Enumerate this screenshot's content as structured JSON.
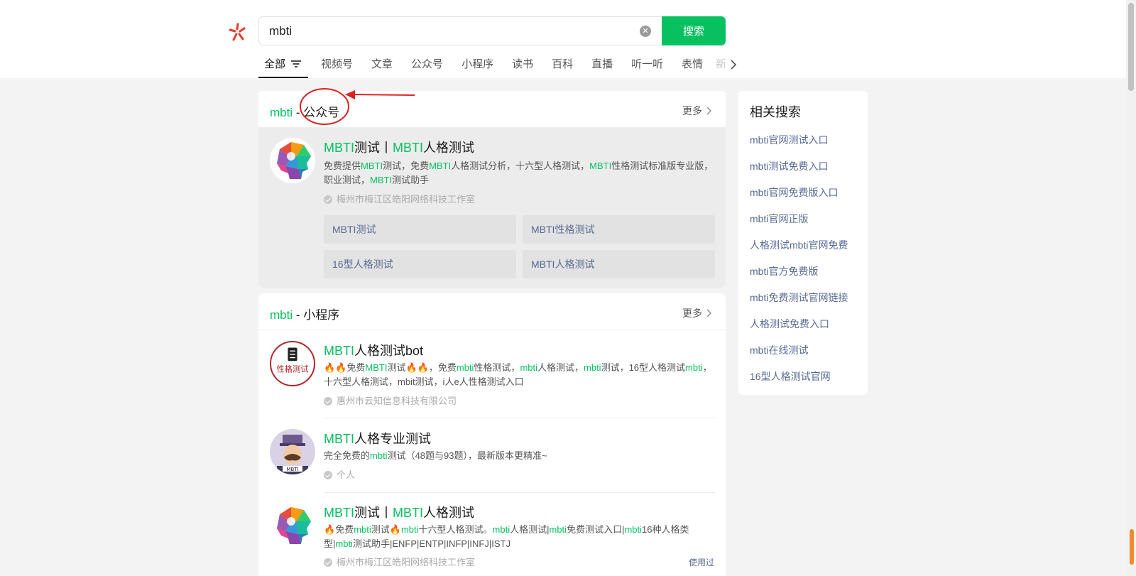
{
  "search": {
    "query": "mbti",
    "clear_icon": "close-circle-icon",
    "button_label": "搜索"
  },
  "tabs": [
    {
      "label": "全部",
      "active": true
    },
    {
      "label": "视频号"
    },
    {
      "label": "文章"
    },
    {
      "label": "公众号"
    },
    {
      "label": "小程序"
    },
    {
      "label": "读书"
    },
    {
      "label": "百科"
    },
    {
      "label": "直播"
    },
    {
      "label": "听一听"
    },
    {
      "label": "表情"
    },
    {
      "label": "新"
    }
  ],
  "accounts": {
    "keyword": "mbti",
    "sep": " - ",
    "title": "公众号",
    "more_label": "更多",
    "item": {
      "title_kw1": "MBTI",
      "title_mid": "测试丨",
      "title_kw2": "MBTI",
      "title_end": "人格测试",
      "desc": [
        "免费提供",
        "MBTI",
        "测试，免费",
        "MBTI",
        "人格测试分析，十六型人格测试，",
        "MBTI",
        "性格测试标准版专业版，职业测试，",
        "MBTI",
        "测试助手"
      ],
      "org": "梅州市梅江区皓阳网络科技工作室",
      "sub_links": [
        "MBTI测试",
        "MBTI性格测试",
        "16型人格测试",
        "MBTI人格测试"
      ]
    }
  },
  "miniprograms": {
    "keyword": "mbti",
    "sep": " - ",
    "title": "小程序",
    "more_label": "更多",
    "items": [
      {
        "title_kw": "MBTI",
        "title_rest": "人格测试bot",
        "desc": [
          "免费",
          "MBTI",
          "测试",
          "，免费",
          "mbti",
          "性格测试，",
          "mbti",
          "人格测试，",
          "mbti",
          "测试，16型人格测试",
          "mbti",
          "，十六型人格测试，mbit测试，i人e人性格测试入口"
        ],
        "org": "惠州市云知信息科技有限公司",
        "avatar_text": "性格测试"
      },
      {
        "title_kw": "MBTI",
        "title_rest": "人格专业测试",
        "desc": [
          "完全免费的",
          "mbti",
          "测试（48题与93题），最新版本更精准~"
        ],
        "org": "个人",
        "avatar_text": "MBTI"
      },
      {
        "title_kw1": "MBTI",
        "title_mid": "测试丨",
        "title_kw2": "MBTI",
        "title_end": "人格测试",
        "desc": [
          "免费",
          "mbti",
          "测试",
          "mbti",
          "十六型人格测试。",
          "mbti",
          "人格测试|",
          "mbti",
          "免费测试入口|",
          "mbti",
          "16种人格类型|",
          "mbti",
          "测试助手|ENFP|ENTP|INFP|INFJ|ISTJ"
        ],
        "org": "梅州市梅江区皓阳网络科技工作室",
        "used_label": "使用过"
      }
    ]
  },
  "related": {
    "title": "相关搜索",
    "items": [
      "mbti官网测试入口",
      "mbti测试免费入口",
      "mbti官网免费版入口",
      "mbti官网正版",
      "人格测试mbti官网免费",
      "mbti官方免费版",
      "mbti免费测试官网链接",
      "人格测试免费入口",
      "mbti在线测试",
      "16型人格测试官网"
    ]
  },
  "colors": {
    "accent": "#07c160",
    "link": "#576b95",
    "annotation": "#e02020"
  }
}
